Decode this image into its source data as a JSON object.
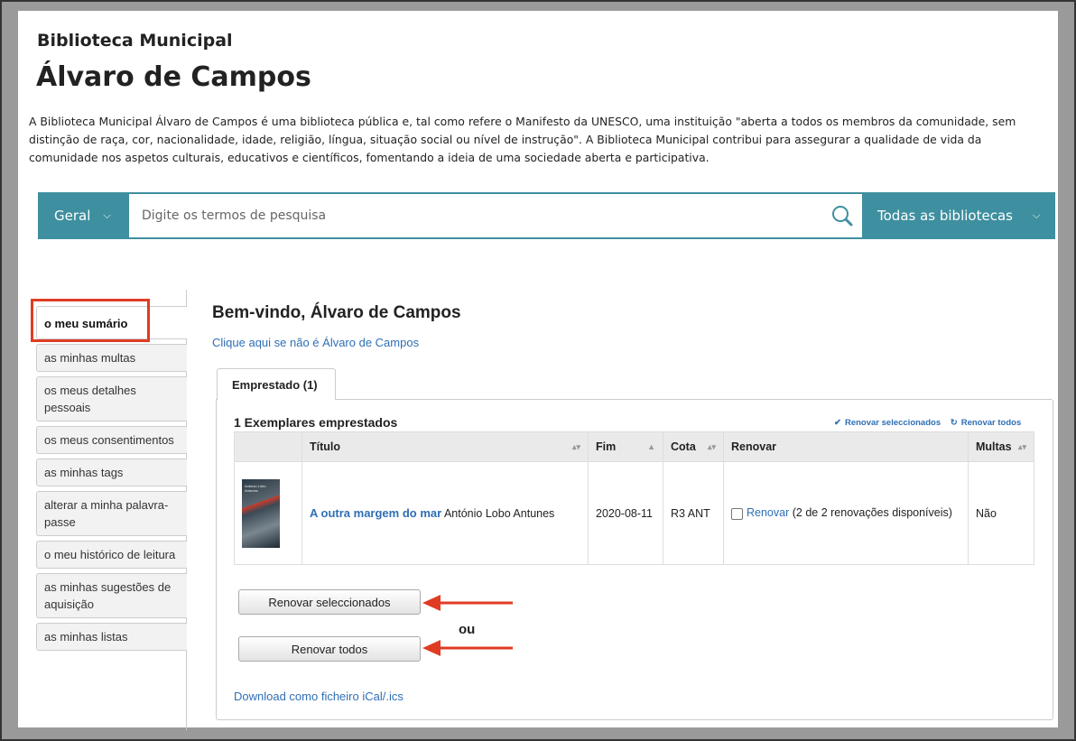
{
  "library": {
    "subtitle": "Biblioteca Municipal",
    "title": "Álvaro de Campos",
    "description": "A Biblioteca Municipal Álvaro de Campos é uma biblioteca pública e, tal como refere o Manifesto da UNESCO, uma instituição \"aberta a todos os membros da comunidade, sem distinção de raça, cor, nacionalidade, idade, religião, língua, situação social ou nível de instrução\". A Biblioteca Municipal contribui para assegurar a qualidade de vida da comunidade nos aspetos culturais, educativos e científicos, fomentando a ideia de uma sociedade aberta e participativa."
  },
  "search": {
    "scope": "Geral",
    "placeholder": "Digite os termos de pesquisa",
    "library_select": "Todas as bibliotecas"
  },
  "sidebar": {
    "items": [
      {
        "label": "o meu sumário"
      },
      {
        "label": "as minhas multas"
      },
      {
        "label": "os meus detalhes pessoais"
      },
      {
        "label": "os meus consentimentos"
      },
      {
        "label": "as minhas tags"
      },
      {
        "label": "alterar a minha palavra-passe"
      },
      {
        "label": "o meu histórico de leitura"
      },
      {
        "label": "as minhas sugestões de aquisição"
      },
      {
        "label": "as minhas listas"
      }
    ]
  },
  "main": {
    "welcome": "Bem-vindo, Álvaro de Campos",
    "not_me": "Clique aqui se não é Álvaro de Campos",
    "tab": "Emprestado (1)",
    "checkout_count": "1 Exemplares emprestados",
    "renew_selected_link": "Renovar seleccionados",
    "renew_all_link": "Renovar todos",
    "table": {
      "headers": [
        "Título",
        "Fim",
        "Cota",
        "Renovar",
        "Multas"
      ],
      "rows": [
        {
          "cover_text": "António Lobo Antunes",
          "title": "A outra margem do mar",
          "author": "António Lobo Antunes",
          "due": "2020-08-11",
          "callnumber": "R3 ANT",
          "renew_link": "Renovar",
          "renew_info": "(2 de 2 renovações disponíveis)",
          "fines": "Não"
        }
      ]
    },
    "btn_renew_selected": "Renovar seleccionados",
    "or_label": "ou",
    "btn_renew_all": "Renovar todos",
    "ical": "Download como ficheiro iCal/.ics"
  },
  "colors": {
    "accent": "#3e8f9f",
    "link": "#2f6fb5",
    "highlight": "#e03c24"
  }
}
